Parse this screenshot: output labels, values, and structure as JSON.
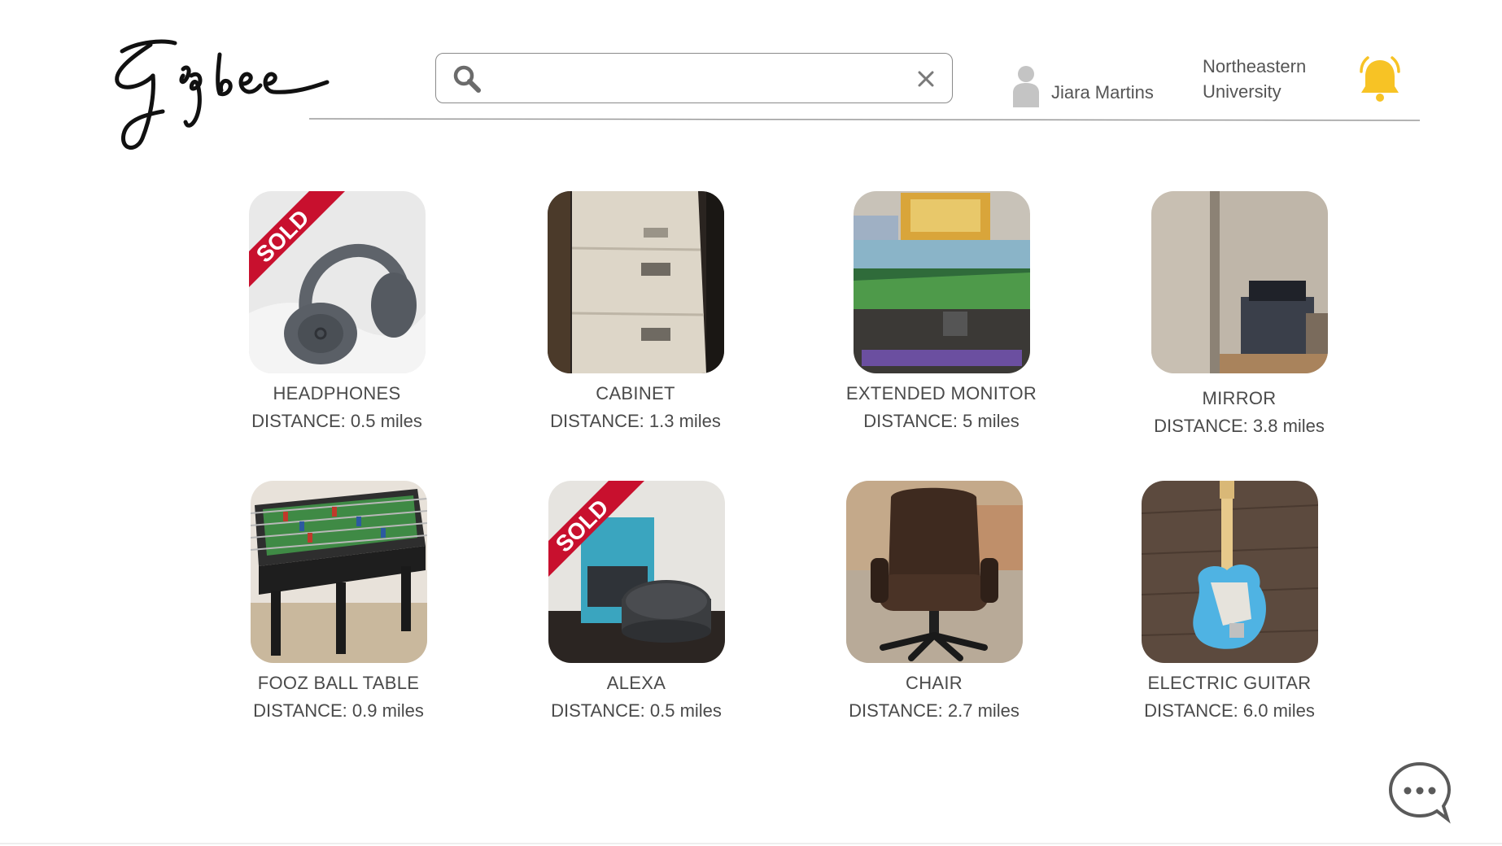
{
  "brand": {
    "name": "Gigbee"
  },
  "search": {
    "value": "",
    "placeholder": ""
  },
  "user": {
    "name": "Jiara Martins",
    "university_line1": "Northeastern",
    "university_line2": "University"
  },
  "colors": {
    "accent": "#F7C325",
    "sold": "#C8102E",
    "text": "#4a4a4a"
  },
  "icons": {
    "search": "search-icon",
    "clear": "close-icon",
    "avatar": "user-icon",
    "notifications": "bell-icon",
    "chat": "chat-bubble-icon"
  },
  "sold_label": "SOLD",
  "items": [
    {
      "name": "HEADPHONES",
      "distance": "DISTANCE: 0.5 miles",
      "sold": true
    },
    {
      "name": "CABINET",
      "distance": "DISTANCE: 1.3 miles",
      "sold": false
    },
    {
      "name": "EXTENDED MONITOR",
      "distance": "DISTANCE: 5 miles",
      "sold": false
    },
    {
      "name": "MIRROR",
      "distance": "DISTANCE: 3.8 miles",
      "sold": false
    },
    {
      "name": "FOOZ BALL TABLE",
      "distance": "DISTANCE: 0.9 miles",
      "sold": false
    },
    {
      "name": "ALEXA",
      "distance": "DISTANCE: 0.5 miles",
      "sold": true
    },
    {
      "name": "CHAIR",
      "distance": "DISTANCE: 2.7 miles",
      "sold": false
    },
    {
      "name": "ELECTRIC GUITAR",
      "distance": "DISTANCE: 6.0 miles",
      "sold": false
    }
  ]
}
